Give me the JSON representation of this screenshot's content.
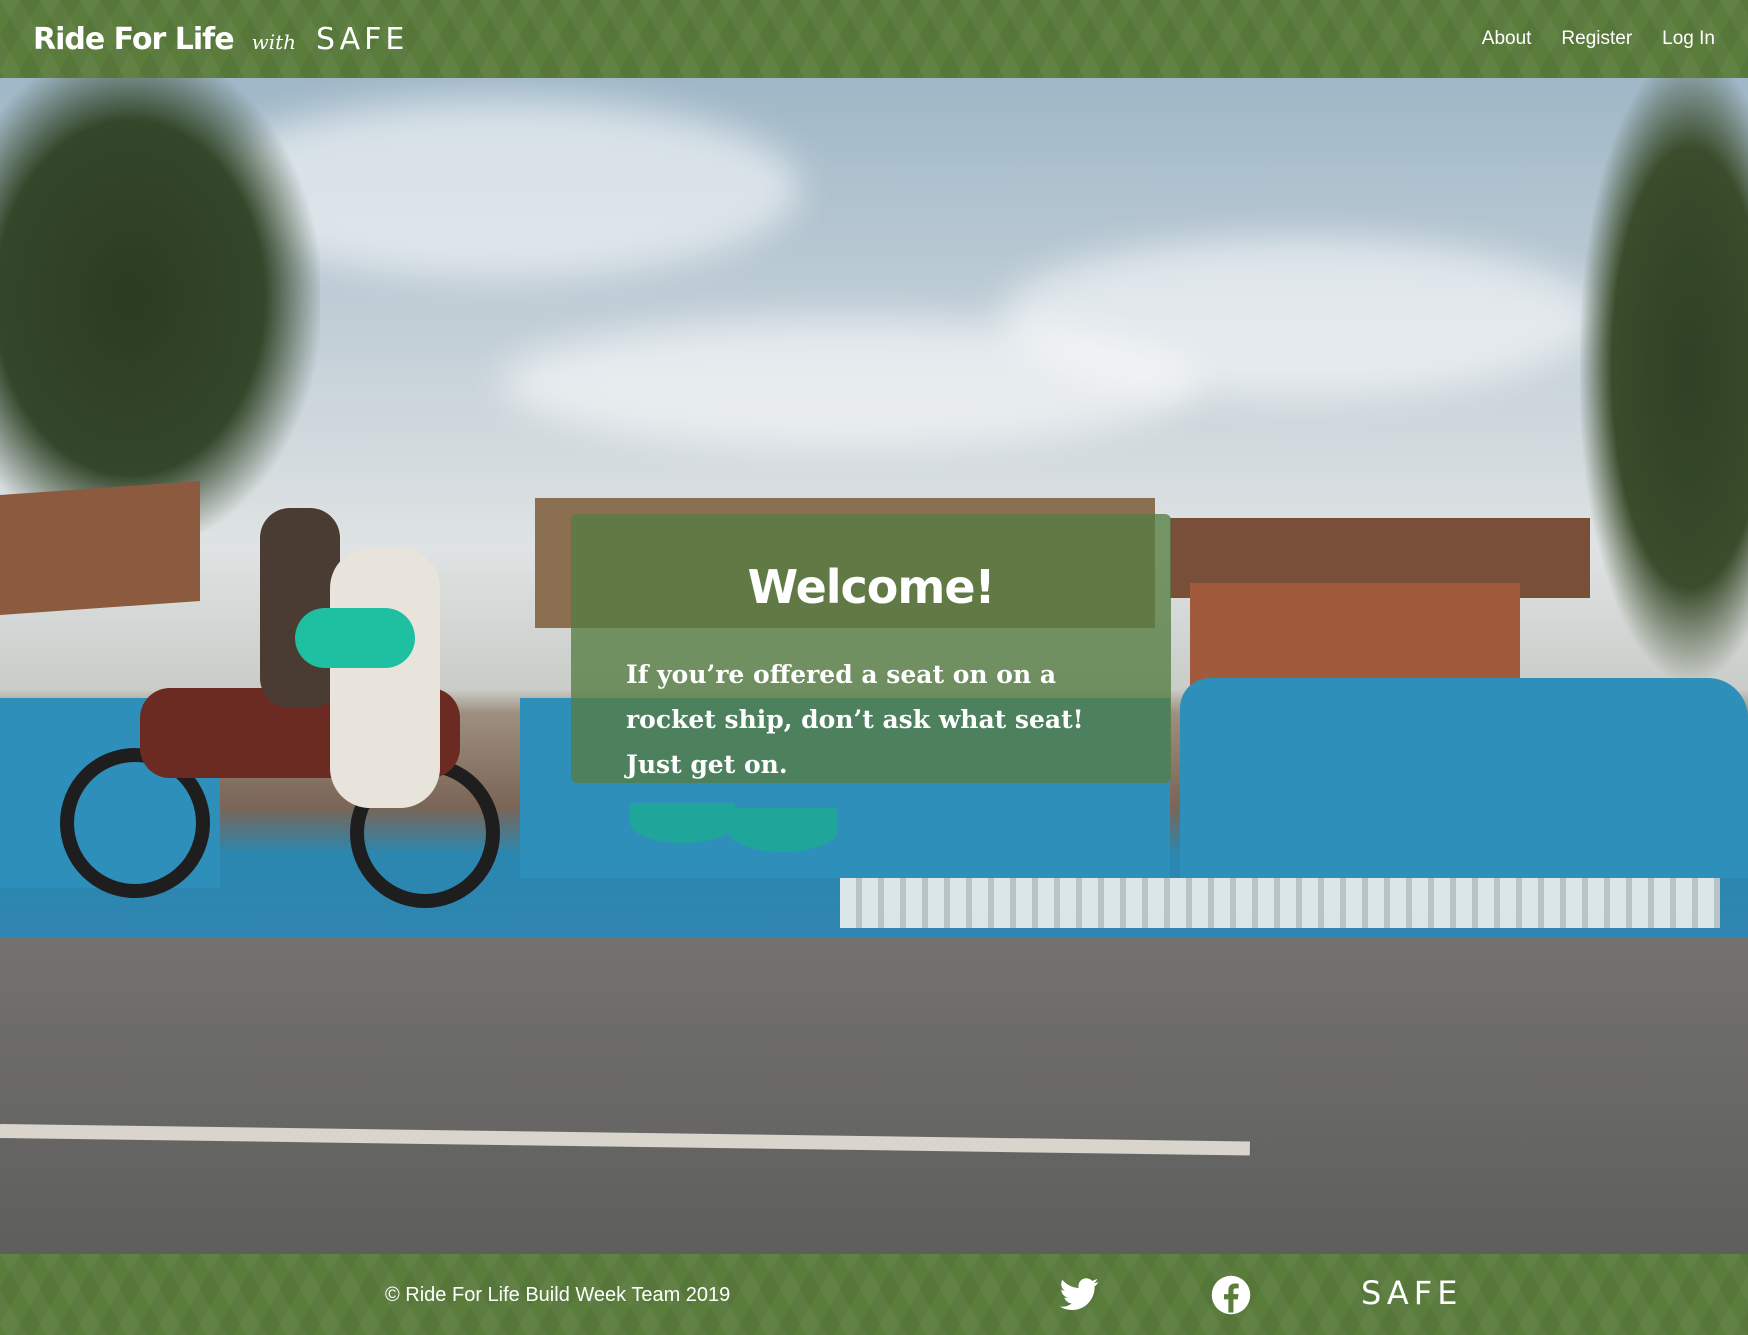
{
  "header": {
    "brand_title": "Ride For Life",
    "brand_with": "with",
    "brand_partner": "SAFE",
    "nav": [
      {
        "label": "About"
      },
      {
        "label": "Register"
      },
      {
        "label": "Log In"
      }
    ]
  },
  "hero": {
    "welcome_title": "Welcome!",
    "welcome_quote": "If you’re offered a seat on on a rocket ship, don’t ask what seat! Just get on."
  },
  "footer": {
    "copyright": "© Ride For Life Build Week Team 2019",
    "social_icons": [
      "twitter-icon",
      "facebook-icon"
    ],
    "partner_logo": "SAFE"
  },
  "colors": {
    "header_green": "#5b7d3c",
    "card_green": "#567e42",
    "text": "#ffffff"
  }
}
